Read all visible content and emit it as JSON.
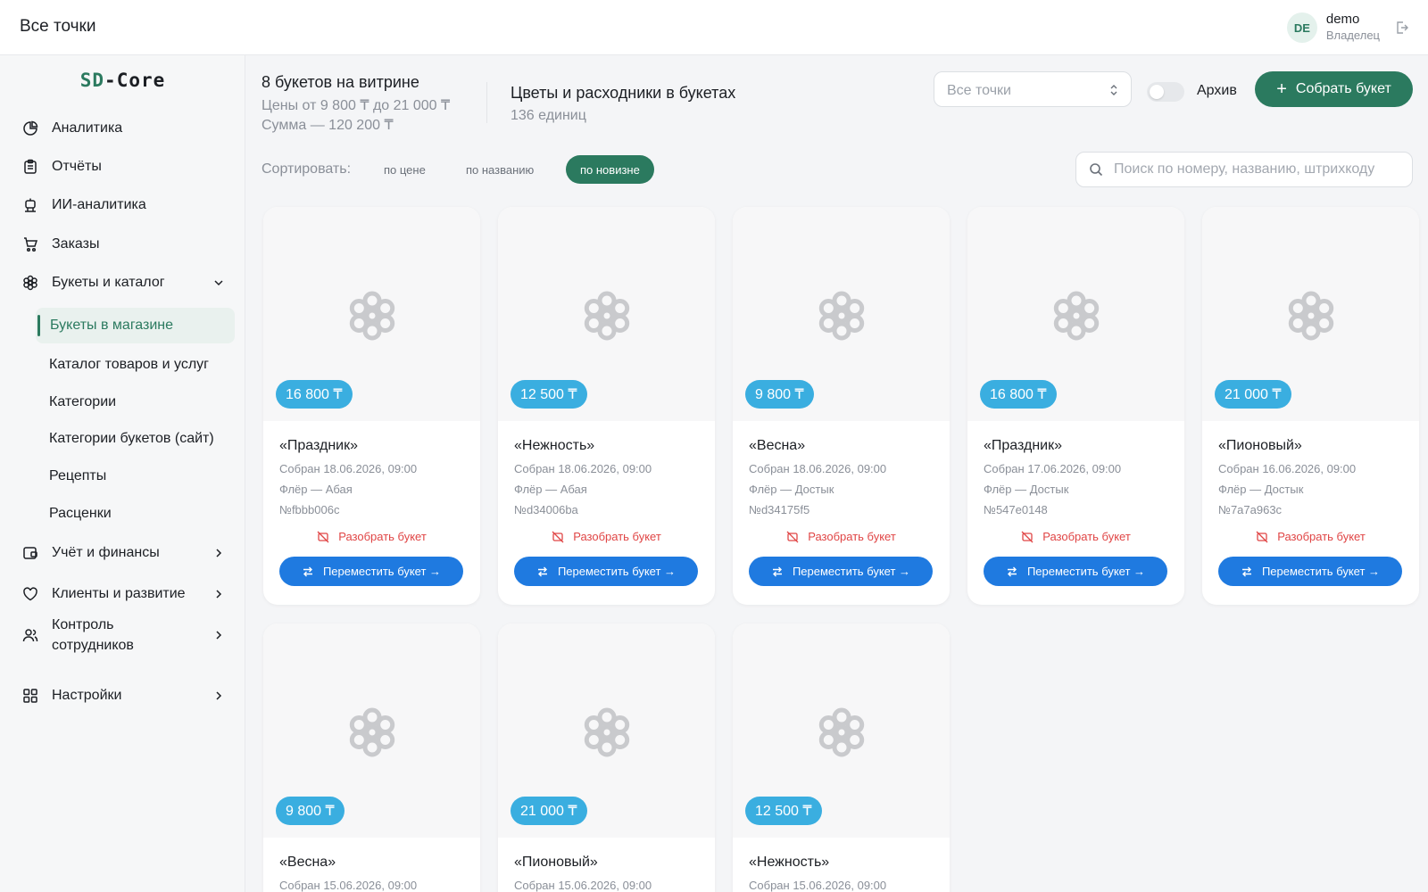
{
  "topbar": {
    "title": "Все точки",
    "user": {
      "initials": "DE",
      "name": "demo",
      "role": "Владелец"
    }
  },
  "sidebar": {
    "logo_a": "SD",
    "logo_sep": "-",
    "logo_b": "Core",
    "items": [
      {
        "label": "Аналитика",
        "icon": "pie-chart-icon"
      },
      {
        "label": "Отчёты",
        "icon": "clipboard-icon"
      },
      {
        "label": "ИИ-аналитика",
        "icon": "robot-icon"
      },
      {
        "label": "Заказы",
        "icon": "cart-icon"
      },
      {
        "label": "Букеты и каталог",
        "icon": "flower-icon"
      },
      {
        "label": "Учёт и финансы",
        "icon": "wallet-icon"
      },
      {
        "label": "Клиенты и развитие",
        "icon": "heart-icon"
      },
      {
        "label_line1": "Контроль",
        "label_line2": "сотрудников",
        "icon": "users-icon"
      },
      {
        "label": "Настройки",
        "icon": "grid-icon"
      }
    ],
    "subitems": [
      "Букеты в магазине",
      "Каталог товаров и услуг",
      "Категории",
      "Категории букетов (сайт)",
      "Рецепты",
      "Расценки"
    ]
  },
  "summary": {
    "count_title": "8 букетов на витрине",
    "price_range": "Цены от 9 800 ₸ до 21 000 ₸",
    "total": "Сумма — 120 200 ₸",
    "materials_title": "Цветы и расходники в букетах",
    "materials_count": "136 единиц"
  },
  "controls": {
    "point_select": "Все точки",
    "archive_label": "Архив",
    "archive_on": false,
    "create_label": "Собрать букет"
  },
  "sort": {
    "label": "Сортировать:",
    "options": [
      "по цене",
      "по названию",
      "по новизне"
    ],
    "active": "по новизне"
  },
  "search": {
    "placeholder": "Поиск по номеру, названию, штрихкоду"
  },
  "cards": [
    {
      "price": "16 800 ₸",
      "name": "«Праздник»",
      "assembled": "Собран 18.06.2026, 09:00",
      "shop": "Флёр — Абая",
      "number": "№fbbb006c",
      "disassemble": "Разобрать букет",
      "move": "Переместить букет →"
    },
    {
      "price": "12 500 ₸",
      "name": "«Нежность»",
      "assembled": "Собран 18.06.2026, 09:00",
      "shop": "Флёр — Абая",
      "number": "№d34006ba",
      "disassemble": "Разобрать букет",
      "move": "Переместить букет →"
    },
    {
      "price": "9 800 ₸",
      "name": "«Весна»",
      "assembled": "Собран 18.06.2026, 09:00",
      "shop": "Флёр — Достык",
      "number": "№d34175f5",
      "disassemble": "Разобрать букет",
      "move": "Переместить букет →"
    },
    {
      "price": "16 800 ₸",
      "name": "«Праздник»",
      "assembled": "Собран 17.06.2026, 09:00",
      "shop": "Флёр — Достык",
      "number": "№547e0148",
      "disassemble": "Разобрать букет",
      "move": "Переместить букет →"
    },
    {
      "price": "21 000 ₸",
      "name": "«Пионовый»",
      "assembled": "Собран 16.06.2026, 09:00",
      "shop": "Флёр — Достык",
      "number": "№7a7a963c",
      "disassemble": "Разобрать букет",
      "move": "Переместить букет →"
    },
    {
      "price": "9 800 ₸",
      "name": "«Весна»",
      "assembled": "Собран 15.06.2026, 09:00"
    },
    {
      "price": "21 000 ₸",
      "name": "«Пионовый»",
      "assembled": "Собран 15.06.2026, 09:00"
    },
    {
      "price": "12 500 ₸",
      "name": "«Нежность»",
      "assembled": "Собран 15.06.2026, 09:00"
    }
  ],
  "colors": {
    "brand": "#2b7a5f",
    "price_badge": "#3aaee0",
    "move_button": "#1f7ae0",
    "danger": "#e04545"
  }
}
